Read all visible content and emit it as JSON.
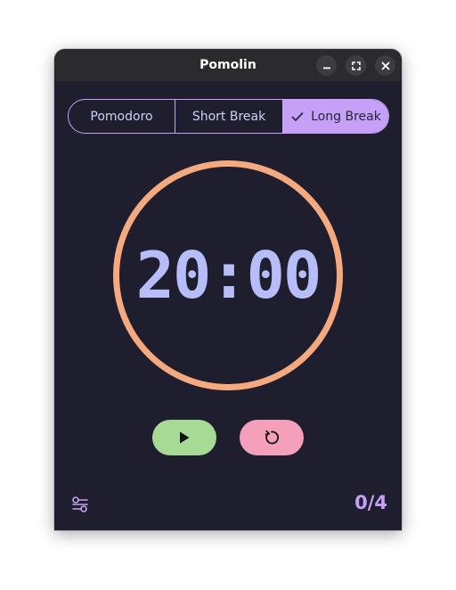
{
  "window": {
    "title": "Pomolin"
  },
  "modes": {
    "items": [
      {
        "label": "Pomodoro",
        "selected": false
      },
      {
        "label": "Short Break",
        "selected": false
      },
      {
        "label": "Long Break",
        "selected": true
      }
    ]
  },
  "timer": {
    "display": "20:00"
  },
  "controls": {
    "play_icon": "play-icon",
    "reset_icon": "reset-icon"
  },
  "footer": {
    "settings_icon": "settings-sliders-icon",
    "session_counter": "0/4"
  },
  "colors": {
    "background": "#1f1e2e",
    "titlebar": "#2b2b2e",
    "accent_purple": "#c6a0f6",
    "ring_orange": "#f5a97f",
    "time_text": "#b7bdf8",
    "play_green": "#a6da95",
    "reset_pink": "#f5a0bb"
  }
}
